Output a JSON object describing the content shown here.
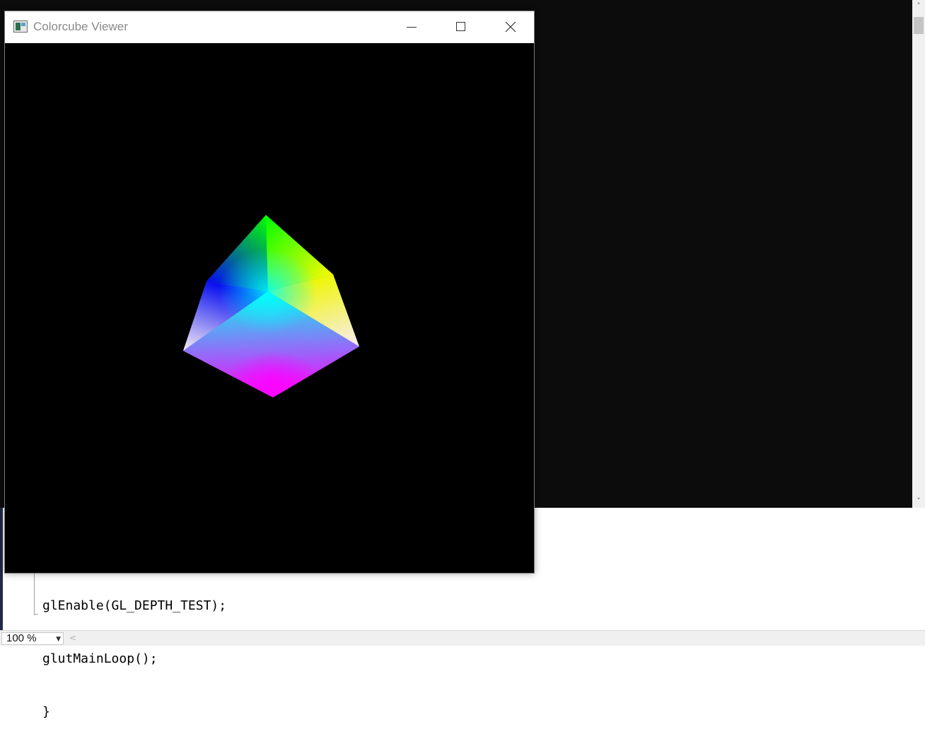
{
  "console": {
    "scroll_up_glyph": "˄",
    "scroll_down_glyph": "˅"
  },
  "window": {
    "title": "Colorcube Viewer",
    "icons": {
      "app": "app-window-icon",
      "minimize": "minimize-icon",
      "maximize": "maximize-icon",
      "close": "close-icon"
    }
  },
  "cube": {
    "vertex_colors": {
      "top": "#00ff00",
      "right": "#ffff00",
      "left": "#0000ff",
      "center": "#00ffff",
      "bottom_right": "#ffffff",
      "bottom_left": "#ffffff",
      "bottom": "#ff00ff"
    }
  },
  "editor": {
    "lines": [
      "glEnable(GL_DEPTH_TEST);",
      "glutMainLoop();",
      "}"
    ]
  },
  "statusbar": {
    "zoom": "100 %",
    "zoom_caret": "▼",
    "scroll_left_glyph": "<"
  }
}
